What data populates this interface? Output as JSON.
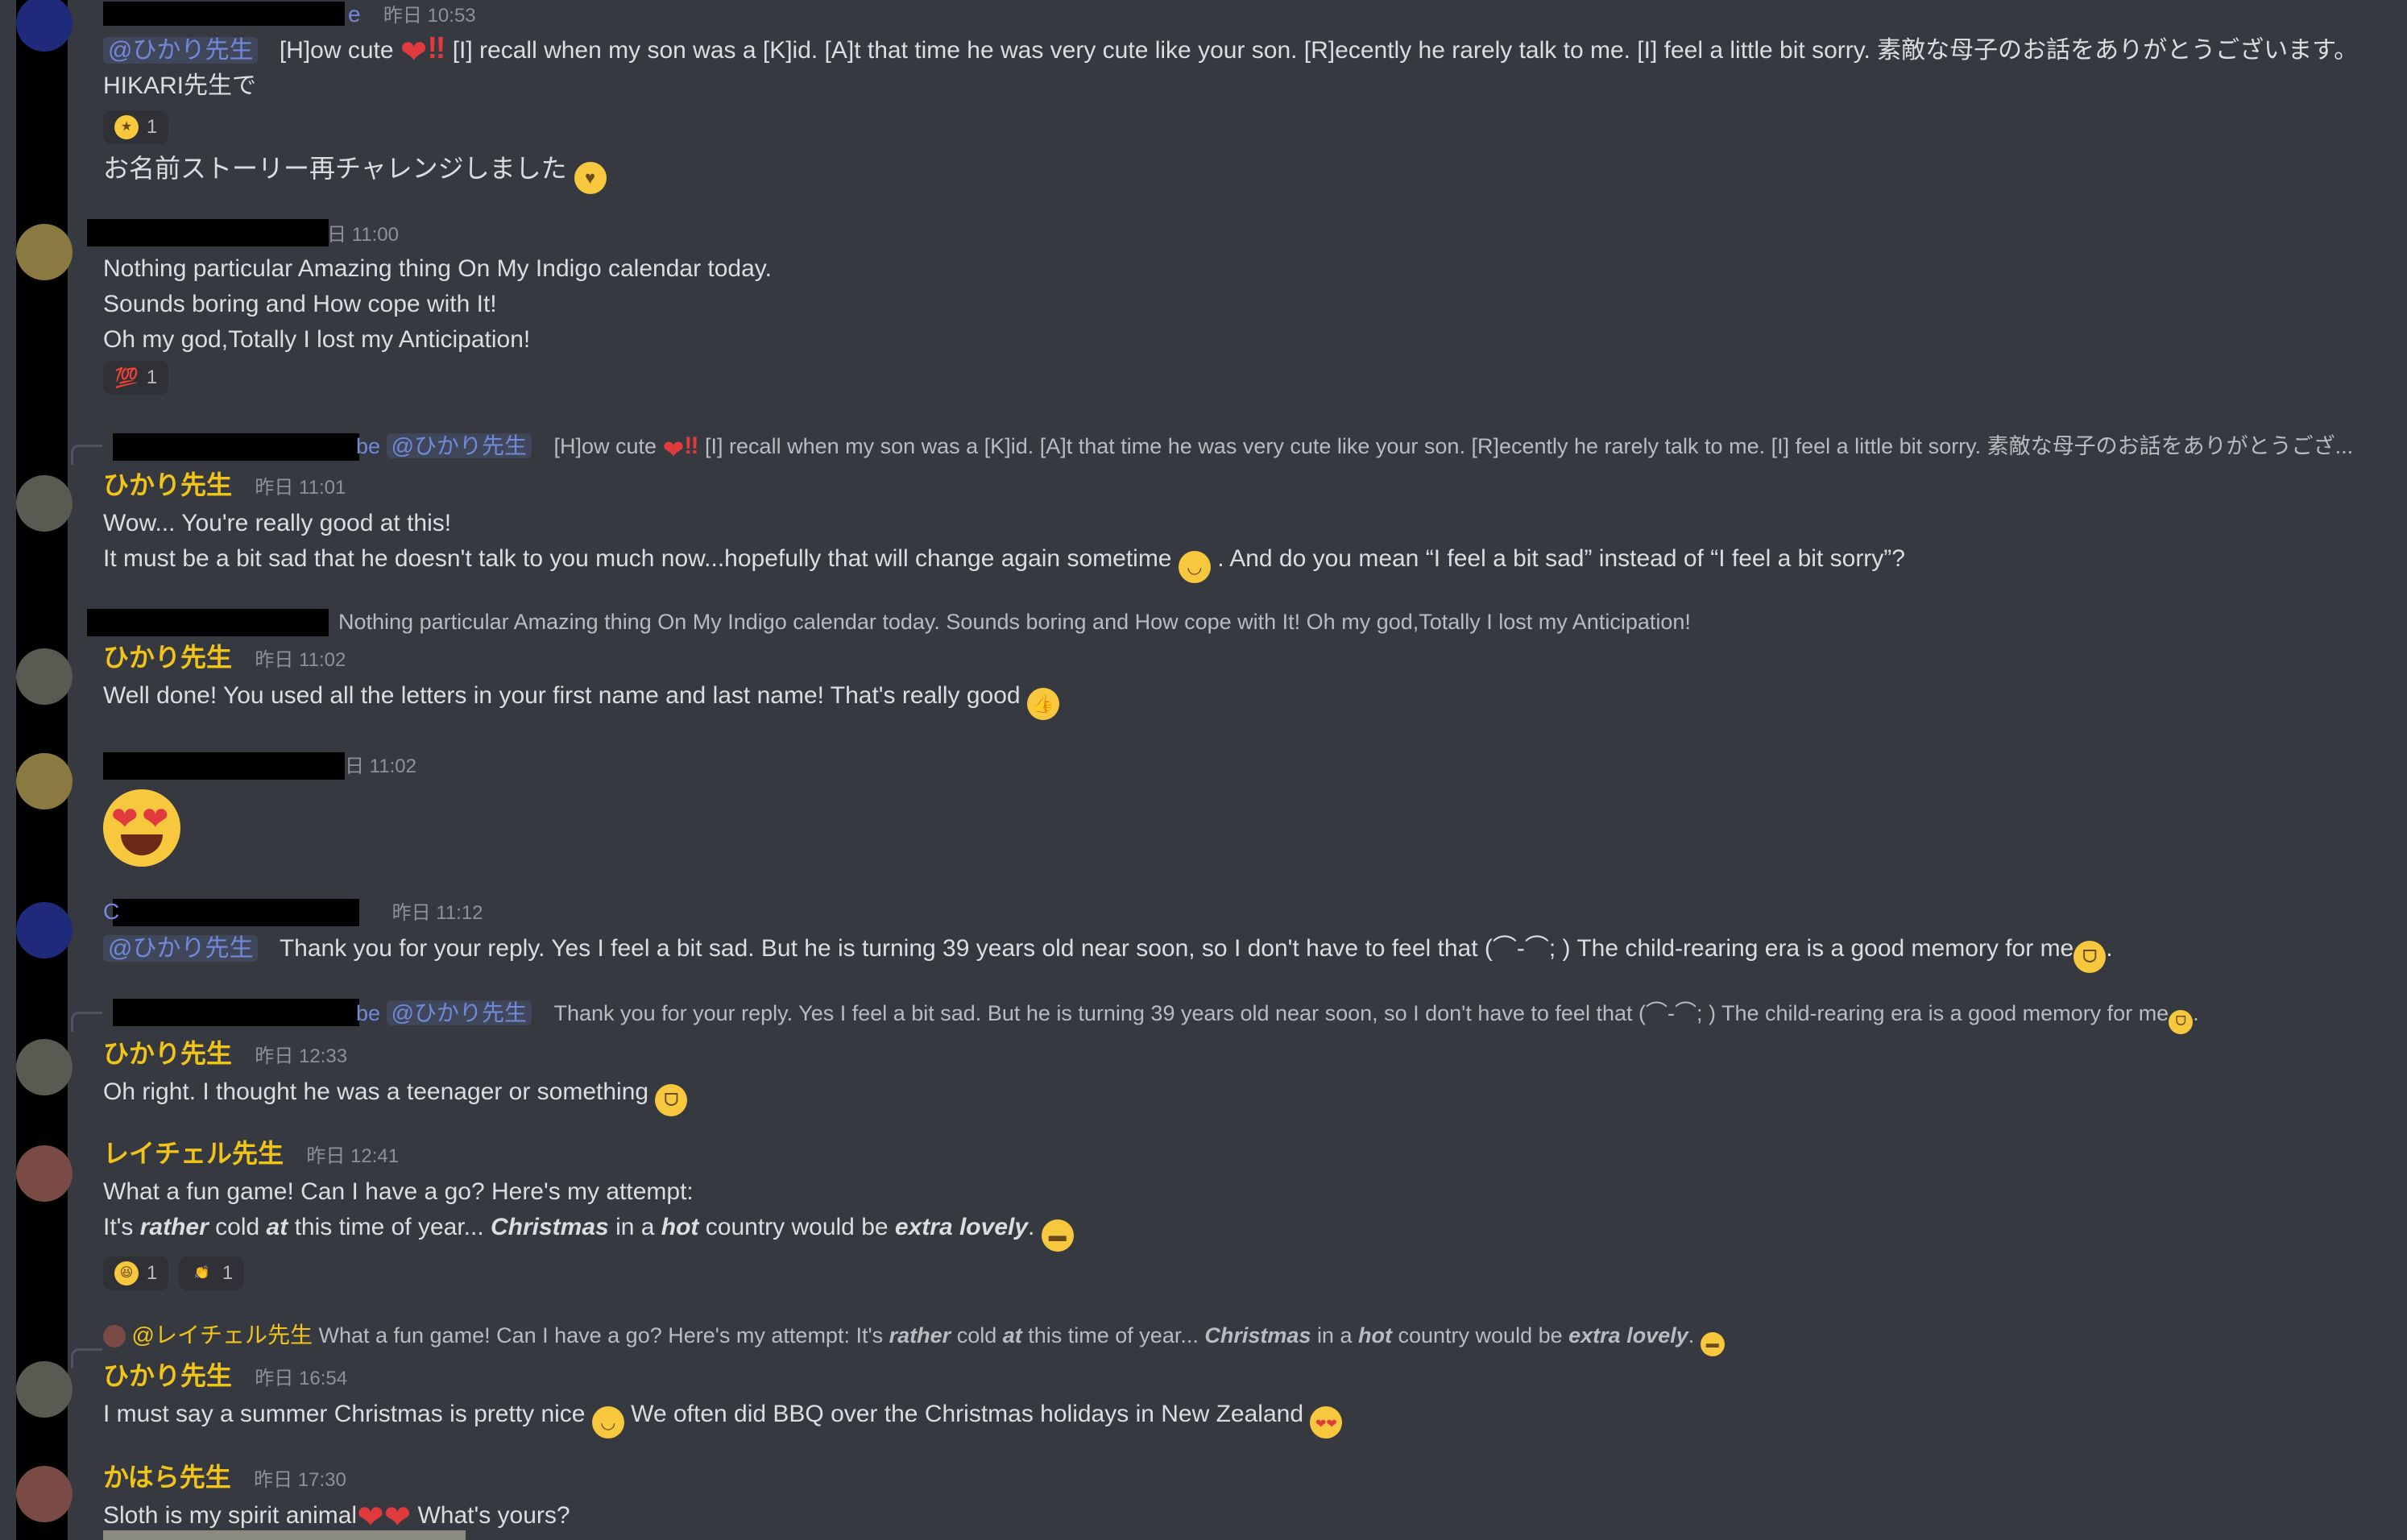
{
  "app": {
    "name": "Chat",
    "accent": "#7289da",
    "name_color": "#f0c419",
    "background": "#36393f"
  },
  "messages": [
    {
      "id": "m1",
      "author_visible_suffix": "e",
      "timestamp": "昨日 10:53",
      "mention": "@ひかり先生",
      "text_a": "[H]ow cute",
      "text_b": "[I] recall when my son was a [K]id. [A]t that time he was very cute like your son. [R]ecently he rarely talk to me. [I] feel a little bit sorry. 素敵な母子のお話をありがとうございます。HIKARI先生で",
      "reaction_count": "1",
      "line2": "お名前ストーリー再チャレンジしました"
    },
    {
      "id": "m2",
      "timestamp": "昨日 11:00",
      "timestamp_visible": "日 11:00",
      "lines": [
        "Nothing particular Amazing thing On My Indigo calendar today.",
        "Sounds boring and How cope with It!",
        "Oh my god,Totally I lost my Anticipation!"
      ],
      "reaction_emoji": "💯",
      "reaction_count": "1"
    },
    {
      "id": "m3",
      "reply_prefix": "be",
      "reply_mention": "@ひかり先生",
      "reply_text_a": "[H]ow cute",
      "reply_text_b": "[I] recall when my son was a [K]id. [A]t that time he was very cute like your son. [R]ecently he rarely talk to me. [I] feel a little bit sorry. 素敵な母子のお話をありがとうござ...",
      "author": "ひかり先生",
      "timestamp": "昨日 11:01",
      "line1": "Wow... You're really good at this!",
      "line2_a": "It must be a bit sad that he doesn't talk to you much now...hopefully that will change again sometime",
      "line2_b": ". And do you mean “I feel a bit sad” instead of “I feel a bit sorry”?"
    },
    {
      "id": "m4",
      "reply_text": "Nothing particular Amazing thing On My Indigo calendar today. Sounds boring and How cope with It! Oh my god,Totally I lost my Anticipation!",
      "author": "ひかり先生",
      "timestamp": "昨日 11:02",
      "line1": "Well done! You used all the letters in your first name and last name! That's really good"
    },
    {
      "id": "m5",
      "timestamp_visible": "日 11:02"
    },
    {
      "id": "m6",
      "author_visible_prefix": "C",
      "timestamp": "昨日 11:12",
      "mention": "@ひかり先生",
      "text": "Thank you for your reply. Yes I feel a bit sad. But he is turning 39 years old near soon, so I don't have to feel that (⌒-⌒; ) The child-rearing era is a good memory for me",
      "text_end": "."
    },
    {
      "id": "m7",
      "reply_prefix": "be",
      "reply_mention": "@ひかり先生",
      "reply_text": "Thank you for your reply. Yes I feel a bit sad. But he is turning 39 years old near soon, so I don't have to feel that (⌒-⌒; ) The child-rearing era is a good memory for me",
      "reply_text_end": ".",
      "author": "ひかり先生",
      "timestamp": "昨日 12:33",
      "line1": "Oh right. I thought he was a teenager or something"
    },
    {
      "id": "m8",
      "author": "レイチェル先生",
      "timestamp": "昨日 12:41",
      "line1": "What a fun game! Can I have a go? Here's my attempt:",
      "p1": "It's",
      "w1": "rather",
      "p2": "cold",
      "w2": "at",
      "p3": "this time of year...",
      "w3": "Christmas",
      "p4": "in a",
      "w4": "hot",
      "p5": "country would be",
      "w5": "extra lovely",
      "p6": ".",
      "reactions": [
        {
          "emoji": "😆",
          "count": "1"
        },
        {
          "emoji": "👏",
          "count": "1"
        }
      ]
    },
    {
      "id": "m9",
      "reply_mention": "@レイチェル先生",
      "r_p1": "What a fun game! Can I have a go? Here's my attempt: It's",
      "r_w1": "rather",
      "r_p2": "cold",
      "r_w2": "at",
      "r_p3": "this time of year...",
      "r_w3": "Christmas",
      "r_p4": "in a",
      "r_w4": "hot",
      "r_p5": "country would be",
      "r_w5": "extra lovely",
      "r_p6": ".",
      "author": "ひかり先生",
      "timestamp": "昨日 16:54",
      "line1_a": "I must say a summer Christmas is pretty nice",
      "line1_b": "We often did BBQ over the Christmas holidays in New Zealand"
    },
    {
      "id": "m10",
      "author": "かはら先生",
      "timestamp": "昨日 17:30",
      "line1_a": "Sloth is my spirit animal",
      "line1_b": "What's yours?"
    }
  ]
}
